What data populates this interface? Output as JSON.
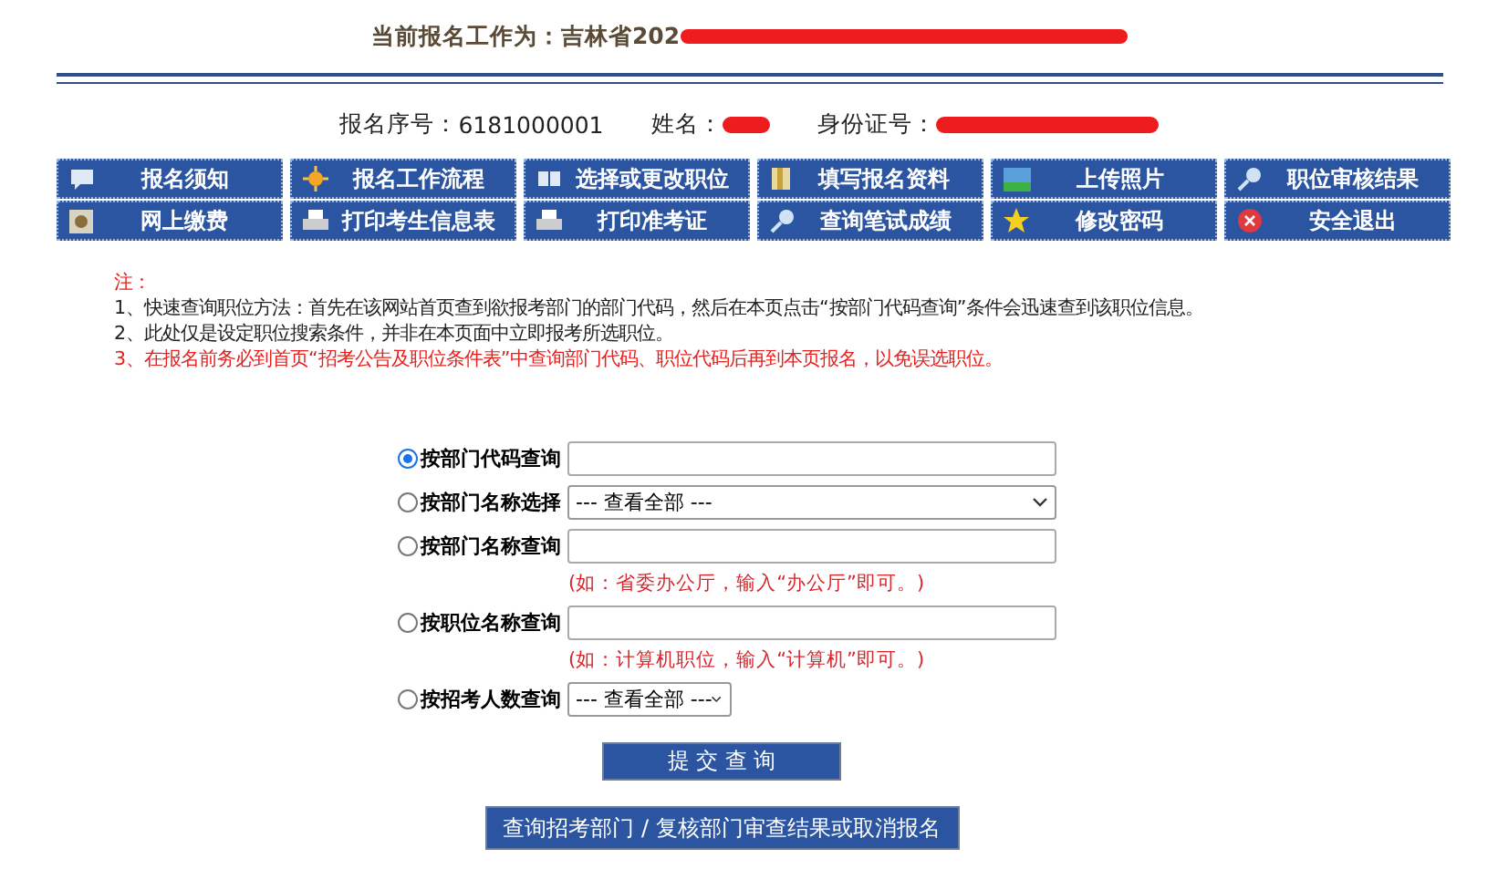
{
  "header": {
    "title": "当前报名工作为：吉林省202",
    "title_redacted": true
  },
  "applicant": [
    {
      "label": "报名序号：",
      "value": "6181000001",
      "redacted": false
    },
    {
      "label": "姓名：",
      "redacted": true
    },
    {
      "label": "身份证号：",
      "redacted": true
    }
  ],
  "menu": [
    {
      "label": "报名须知"
    },
    {
      "label": "报名工作流程"
    },
    {
      "label": "选择或更改职位"
    },
    {
      "label": "填写报名资料"
    },
    {
      "label": "上传照片"
    },
    {
      "label": "职位审核结果"
    },
    {
      "label": "网上缴费"
    },
    {
      "label": "打印考生信息表"
    },
    {
      "label": "打印准考证"
    },
    {
      "label": "查询笔试成绩"
    },
    {
      "label": "修改密码"
    },
    {
      "label": "安全退出"
    }
  ],
  "notes": {
    "heading": "注：",
    "items": [
      {
        "text": "1、快速查询职位方法：首先在该网站首页查到欲报考部门的部门代码，然后在本页点击“按部门代码查询”条件会迅速查到该职位信息。",
        "warning": false
      },
      {
        "text": "2、此处仅是设定职位搜索条件，并非在本页面中立即报考所选职位。",
        "warning": false
      },
      {
        "text": "3、在报名前务必到首页“招考公告及职位条件表”中查询部门代码、职位代码后再到本页报名，以免误选职位。",
        "warning": true
      }
    ]
  },
  "search_options": [
    {
      "label": "按部门代码查询",
      "selected": true,
      "kind": "text"
    },
    {
      "label": "按部门名称选择",
      "selected": false,
      "kind": "select",
      "value": "--- 查看全部 ---"
    },
    {
      "label": "按部门名称查询",
      "selected": false,
      "kind": "text",
      "hint": "(如：省委办公厅，输入“办公厅”即可。)"
    },
    {
      "label": "按职位名称查询",
      "selected": false,
      "kind": "text",
      "hint": "(如：计算机职位，输入“计算机”即可。)"
    },
    {
      "label": "按招考人数查询",
      "selected": false,
      "kind": "small-select",
      "value": "--- 查看全部 ---"
    }
  ],
  "buttons": {
    "submit": "提 交 查 询",
    "secondary": "查询招考部门 / 复核部门审查结果或取消报名"
  }
}
